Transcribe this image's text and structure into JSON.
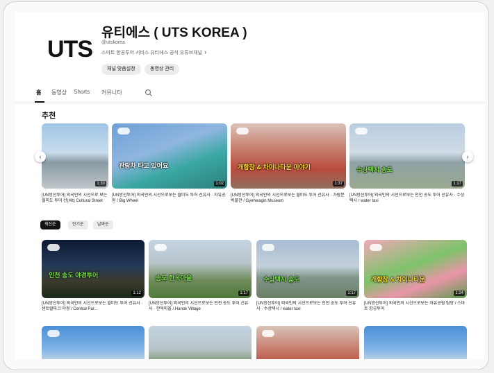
{
  "channel": {
    "logo_text": "UTS",
    "title": "유티에스 ( UTS KOREA )",
    "handle": "@utskorea",
    "description": "스마트 항공투어 서비스 유티에스 공식 유튜브채널",
    "buttons": [
      "채널 맞춤설정",
      "동영상 관리"
    ]
  },
  "tabs": {
    "items": [
      "홈",
      "동영상",
      "Shorts",
      "커뮤니티"
    ],
    "active": "홈"
  },
  "recommended": {
    "title": "추천",
    "videos": [
      {
        "duration": "1:33",
        "caption": "[UN방선투어] 외국인의 시선으로 보는 월미도 투어 선(Hit) Cultural Street",
        "overlay": ""
      },
      {
        "duration": "1:02",
        "caption": "[UN방선투어] 외국인의 시선으로보는 월미도 투어 선유사 · 자유공원 / Big Wheel",
        "overlay": "관람차 타고 있어요"
      },
      {
        "duration": "1:37",
        "caption": "[UN방선투어] 외국인의 시선으로보는 월미도 투어 선유사 · 가람문 박물관 / Gyehwagin Museum",
        "overlay": "개항장 & 차이나타운 이야기"
      },
      {
        "duration": "1:17",
        "caption": "[UN방선투어] 외국인의 시선으로보는 인천 송도 투어 선유사 · 수상택시 / water taxi",
        "overlay": "수상택시 송도"
      }
    ]
  },
  "filters": [
    "최신순",
    "인기순",
    "날짜순"
  ],
  "grid": [
    {
      "duration": "1:12",
      "caption": "[UN방선투어] 외국인의 시선으로보는 월미도 투어 선유사 · 센트럴파크 야경 / Central Par...",
      "overlay": "인천 송도 야경투어"
    },
    {
      "duration": "1:17",
      "caption": "[UN방선투어] 외국인의 시선으로보는 인천 송도 투어 선유사 · 한옥마을 / Hanok Village",
      "overlay": "송도 한옥마을"
    },
    {
      "duration": "1:17",
      "caption": "[UN방선투어] 외국인의 시선으로보는 인천 송도 투어 선유사 · 수상택시 / water taxi",
      "overlay": "수상택시 송도"
    },
    {
      "duration": "1:24",
      "caption": "[UN방선투어] 외국인의 시선으로보는 자유공원 탐방 / 스마트 항공투어",
      "overlay": "개항장 & 차이나타운"
    },
    {
      "duration": "",
      "caption": "",
      "overlay": ""
    },
    {
      "duration": "",
      "caption": "",
      "overlay": ""
    },
    {
      "duration": "",
      "caption": "",
      "overlay": ""
    },
    {
      "duration": "",
      "caption": "",
      "overlay": ""
    }
  ],
  "nav": {
    "prev": "‹",
    "next": "›"
  },
  "icons": {
    "search": "search-icon",
    "chevron": "chevron-right-icon"
  }
}
